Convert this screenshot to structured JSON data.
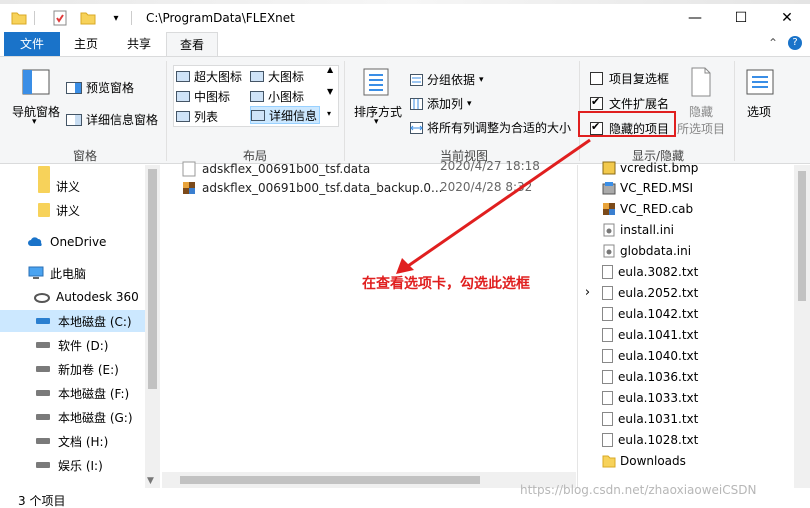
{
  "window": {
    "path": "C:\\ProgramData\\FLEXnet",
    "controls": {
      "minimize": "—",
      "maximize": "☐",
      "close": "✕"
    },
    "ribbon_toggle": "⌃",
    "help": "?"
  },
  "tabs": [
    "文件",
    "主页",
    "共享",
    "查看"
  ],
  "ribbon": {
    "panes": {
      "nav_pane": "导航窗格",
      "preview_pane": "预览窗格",
      "details_pane": "详细信息窗格",
      "group_label": "窗格"
    },
    "layout": {
      "items": [
        "超大图标",
        "大图标",
        "中图标",
        "小图标",
        "列表",
        "详细信息"
      ],
      "group_label": "布局"
    },
    "current_view": {
      "sort_by": "排序方式",
      "group_by": "分组依据",
      "add_columns": "添加列",
      "fit_columns": "将所有列调整为合适的大小",
      "group_label": "当前视图"
    },
    "show_hide": {
      "item_checkboxes": "项目复选框",
      "file_extensions": "文件扩展名",
      "hidden_items": "隐藏的项目",
      "hide": "隐藏",
      "selected_items": "所选项目",
      "group_label": "显示/隐藏",
      "item_checkboxes_checked": false,
      "file_extensions_checked": true,
      "hidden_items_checked": true
    },
    "options": "选项"
  },
  "nav": {
    "items": [
      "讲义",
      "讲义",
      "OneDrive",
      "此电脑",
      "Autodesk 360",
      "本地磁盘 (C:)",
      "软件 (D:)",
      "新加卷 (E:)",
      "本地磁盘 (F:)",
      "本地磁盘 (G:)",
      "文档 (H:)",
      "娱乐 (I:)"
    ]
  },
  "files": [
    {
      "name": "adskflex_00691b00_tsf.data",
      "date": "2020/4/27 18:18"
    },
    {
      "name": "adskflex_00691b00_tsf.data_backup.0...",
      "date": "2020/4/28 8:32"
    }
  ],
  "right_list": {
    "items": [
      "vcredist.bmp",
      "VC_RED.MSI",
      "VC_RED.cab",
      "install.ini",
      "globdata.ini",
      "eula.3082.txt",
      "eula.2052.txt",
      "eula.1042.txt",
      "eula.1041.txt",
      "eula.1040.txt",
      "eula.1036.txt",
      "eula.1033.txt",
      "eula.1031.txt",
      "eula.1028.txt",
      "Downloads"
    ]
  },
  "annotation": "在查看选项卡，勾选此选框",
  "status": "3 个项目",
  "watermark": "https://blog.csdn.net/zhaoxiaoweiCSDN",
  "colors": {
    "accent": "#1a73c9",
    "annotation": "#e01f1f"
  }
}
